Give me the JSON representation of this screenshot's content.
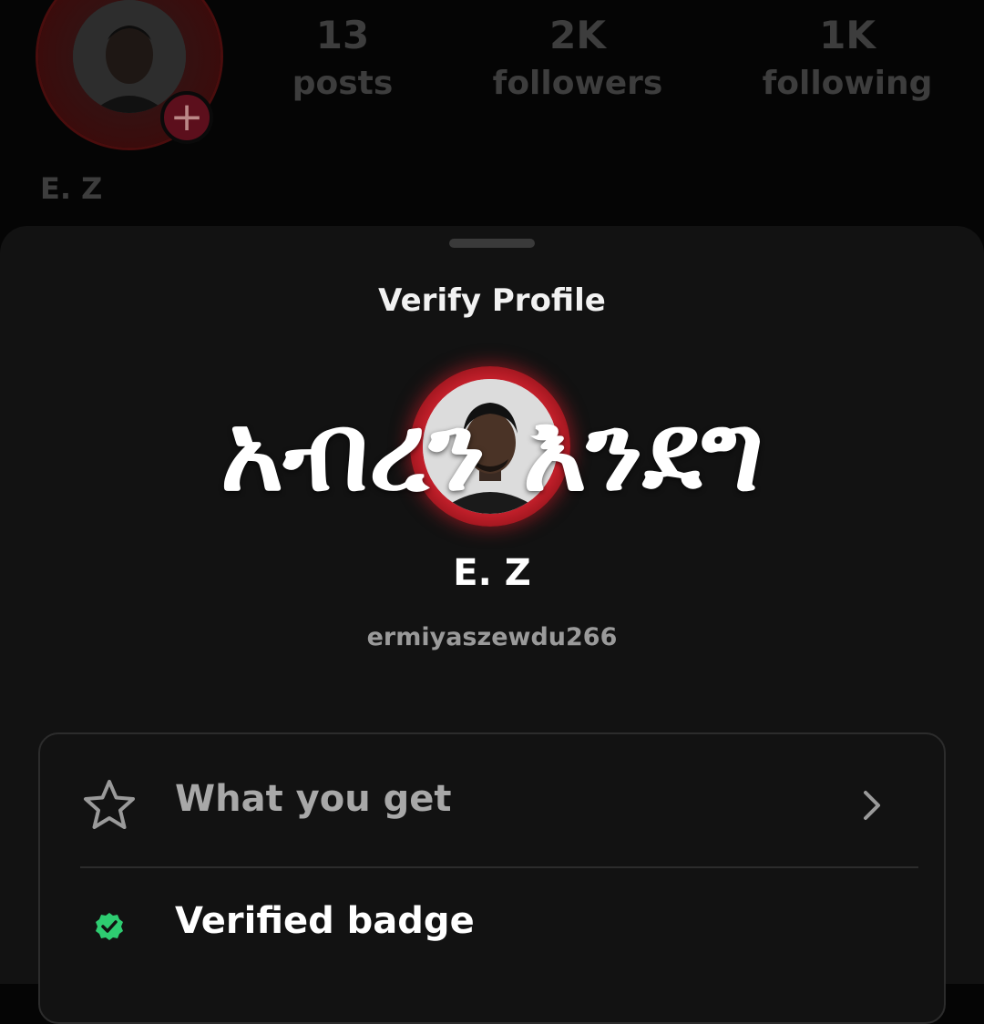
{
  "profile_header": {
    "stats": [
      {
        "value": "13",
        "label": "posts"
      },
      {
        "value": "2K",
        "label": "followers"
      },
      {
        "value": "1K",
        "label": "following"
      }
    ],
    "add_icon": "plus-icon",
    "display_name": "E. Z"
  },
  "sheet": {
    "title": "Verify Profile",
    "overlay_caption": "አብረን እንደግ",
    "display_name": "E. Z",
    "username": "ermiyaszewdu266",
    "options": [
      {
        "label": "What you get",
        "icon": "star-outline-icon",
        "chevron": "chevron-right-icon"
      },
      {
        "label": "Verified badge",
        "icon": "verified-badge-icon",
        "icon_color": "#2ecc71"
      }
    ]
  },
  "colors": {
    "accent_red": "#c21f2a",
    "verified_green": "#2ecc71",
    "sheet_bg": "#121212"
  }
}
